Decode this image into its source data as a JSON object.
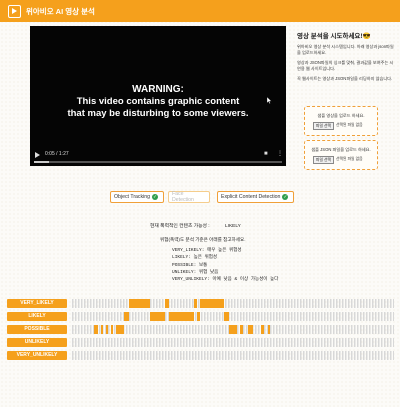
{
  "app": {
    "title": "위아비오 AI 영상 분석"
  },
  "video": {
    "warning_title": "WARNING:",
    "warning_line1": "This video contains graphic content",
    "warning_line2": "that may be disturbing to some viewers.",
    "time": "0:05 / 1:27",
    "progress": 0.06
  },
  "side": {
    "title": "영상 분석을 시도하세요!😎",
    "para1": "위아비오 영상 분석 시스템입니다. 아래 영상과 json파일을 업로드하세요.",
    "para2": "영상과 JSON파일의 싱크를 맞춰, 결과값을 보여주는 시연용 웹 사이트입니다.",
    "para3": "꼭 웹사이트는 영상과 JSON파일을 리딩하지 않습니다.",
    "upload1_label": "샘플 영상을 업로드 하세요.",
    "upload1_button": "파일 선택",
    "upload1_status": "선택된 파일 없음",
    "upload2_label": "샘플 JSON 파일을 업로드 하세요.",
    "upload2_button": "파일 선택",
    "upload2_status": "선택된 파일 없음"
  },
  "tabs": [
    {
      "label": "Object Tracking",
      "checked": true
    },
    {
      "label": "Face Detection",
      "checked": false
    },
    {
      "label": "Explicit Content Detection",
      "checked": true
    }
  ],
  "result": {
    "label": "현재 폭력적인 컨텐츠 가능성 :",
    "value": "LIKELY",
    "legend_title": "위험(폭력)도 분석 기준은 아래를 참고하세요.",
    "legend": [
      "VERY_LIKELY: 매우 높은 위험성",
      "LIKELY: 높은 위험성",
      "POSSIBLE: 보통",
      "UNLIKELY: 위험 낮음",
      "VERY_UNLIKELY: 아예 낮음 & 이상 가능성이 높다"
    ]
  },
  "timeline": {
    "duration": 87,
    "rows": [
      {
        "label": "VERY_LIKELY",
        "segments": [
          [
            15.5,
            21.0
          ],
          [
            25.0,
            26.2
          ],
          [
            33.0,
            33.8
          ],
          [
            34.5,
            41.0
          ]
        ]
      },
      {
        "label": "LIKELY",
        "segments": [
          [
            14.0,
            15.5
          ],
          [
            21.0,
            25.0
          ],
          [
            26.2,
            33.0
          ],
          [
            33.8,
            34.5
          ],
          [
            41.0,
            42.5
          ]
        ]
      },
      {
        "label": "POSSIBLE",
        "segments": [
          [
            6.0,
            7.0
          ],
          [
            7.8,
            8.4
          ],
          [
            9.2,
            9.8
          ],
          [
            10.5,
            11.2
          ],
          [
            12.0,
            14.0
          ],
          [
            42.5,
            44.5
          ],
          [
            45.5,
            46.3
          ],
          [
            47.5,
            49.0
          ],
          [
            51.0,
            51.8
          ],
          [
            53.0,
            53.6
          ]
        ]
      },
      {
        "label": "UNLIKELY",
        "segments": []
      },
      {
        "label": "VERY_UNLIKELY",
        "segments": []
      }
    ]
  }
}
